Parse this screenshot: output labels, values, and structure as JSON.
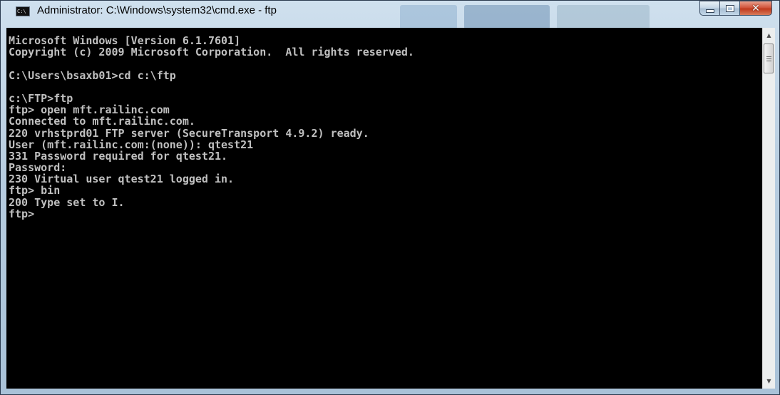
{
  "window": {
    "title": "Administrator: C:\\Windows\\system32\\cmd.exe - ftp",
    "icon_label": "C:\\",
    "buttons": {
      "minimize": "minimize-icon",
      "maximize": "maximize-icon",
      "close": "close-icon"
    }
  },
  "console": {
    "lines": [
      "Microsoft Windows [Version 6.1.7601]",
      "Copyright (c) 2009 Microsoft Corporation.  All rights reserved.",
      "",
      "C:\\Users\\bsaxb01>cd c:\\ftp",
      "",
      "c:\\FTP>ftp",
      "ftp> open mft.railinc.com",
      "Connected to mft.railinc.com.",
      "220 vrhstprd01 FTP server (SecureTransport 4.9.2) ready.",
      "User (mft.railinc.com:(none)): qtest21",
      "331 Password required for qtest21.",
      "Password:",
      "230 Virtual user qtest21 logged in.",
      "ftp> bin",
      "200 Type set to I.",
      "ftp>"
    ]
  },
  "scrollbar": {
    "up_arrow": "▲",
    "down_arrow": "▼"
  },
  "colors": {
    "console_bg": "#000000",
    "console_fg": "#c0c0c0",
    "close_button": "#c8432a",
    "frame": "#b7cde0"
  }
}
